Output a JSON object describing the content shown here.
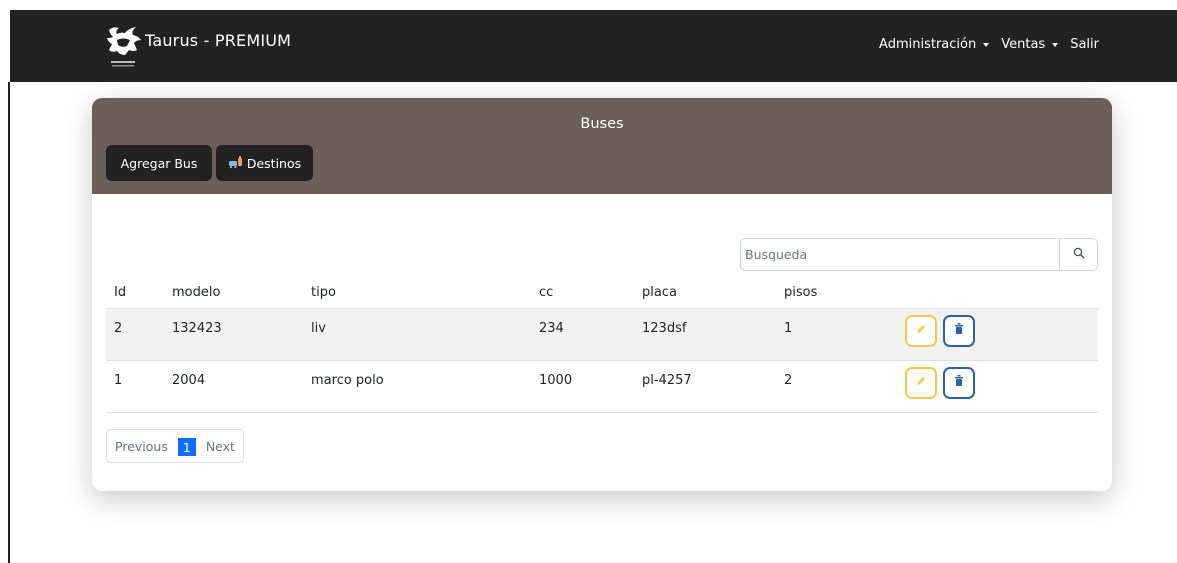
{
  "navbar": {
    "brand_title": "Taurus - PREMIUM",
    "menu": [
      {
        "label": "Administración",
        "has_dropdown": true
      },
      {
        "label": "Ventas",
        "has_dropdown": true
      },
      {
        "label": "Salir",
        "has_dropdown": false
      }
    ]
  },
  "card": {
    "title": "Buses",
    "buttons": {
      "agregar_label": "Agregar Bus",
      "destinos_label": "Destinos",
      "destinos_icon": "bus-icon"
    }
  },
  "search": {
    "placeholder": "Busqueda",
    "icon": "search-icon"
  },
  "table": {
    "columns": [
      "Id",
      "modelo",
      "tipo",
      "cc",
      "placa",
      "pisos"
    ],
    "rows": [
      {
        "id": "2",
        "modelo": "132423",
        "tipo": "liv",
        "cc": "234",
        "placa": "123dsf",
        "pisos": "1"
      },
      {
        "id": "1",
        "modelo": "2004",
        "tipo": "marco polo",
        "cc": "1000",
        "placa": "pl-4257",
        "pisos": "2"
      }
    ],
    "row_actions": [
      {
        "name": "edit",
        "icon": "pencil-icon",
        "color": "#f2c94c"
      },
      {
        "name": "delete",
        "icon": "trash-icon",
        "color": "#2f5fa7"
      }
    ]
  },
  "pagination": {
    "previous_label": "Previous",
    "current_page": "1",
    "next_label": "Next"
  },
  "colors": {
    "navbar": "#222222",
    "card_header": "#6b5f58",
    "page_active": "#0d6efd"
  }
}
